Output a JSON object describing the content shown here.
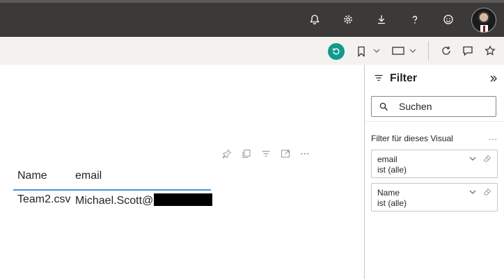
{
  "topbar": {
    "icons": [
      "bell-icon",
      "gear-icon",
      "download-icon",
      "help-icon",
      "smiley-icon"
    ],
    "avatar": "user-avatar"
  },
  "toolbar": {
    "icons": [
      "reset-icon",
      "bookmark-icon",
      "chevron-down-icon",
      "view-icon",
      "chevron-down-icon",
      "refresh-icon",
      "comment-icon",
      "star-icon"
    ],
    "accent_color": "#129a8b"
  },
  "visual": {
    "header_icons": [
      "pin-icon",
      "copy-icon",
      "filter-icon",
      "focus-mode-icon",
      "more-options-icon"
    ],
    "table": {
      "columns": [
        "Name",
        "email"
      ],
      "rows": [
        {
          "name": "Team2.csv",
          "email": "Michael.Scott@"
        }
      ],
      "header_underline_color": "#4a90d9"
    }
  },
  "filter_pane": {
    "title": "Filter",
    "search_placeholder": "Suchen",
    "section_label": "Filter für dieses Visual",
    "more": "...",
    "cards": [
      {
        "field": "email",
        "state": "ist (alle)"
      },
      {
        "field": "Name",
        "state": "ist (alle)"
      }
    ]
  }
}
